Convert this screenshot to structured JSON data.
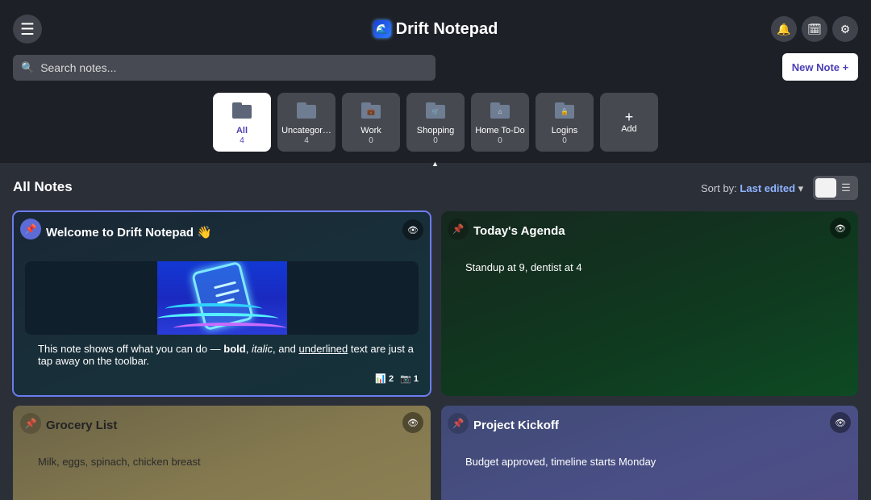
{
  "app": {
    "title": "Drift Notepad",
    "logo_glyph": "🌊",
    "menu_glyph": "☰",
    "bell_glyph": "🔔",
    "calendar_glyph": "🗓",
    "settings_glyph": "⚙"
  },
  "search": {
    "placeholder": "Search notes...",
    "icon_glyph": "🔍"
  },
  "new_note_label": "New Note +",
  "folders": [
    {
      "name": "All",
      "count": "4",
      "glyph": ""
    },
    {
      "name": "Uncategor…",
      "count": "4",
      "glyph": ""
    },
    {
      "name": "Work",
      "count": "0",
      "glyph": "💼"
    },
    {
      "name": "Shopping",
      "count": "0",
      "glyph": "🛒"
    },
    {
      "name": "Home To-Do",
      "count": "0",
      "glyph": "⌂"
    },
    {
      "name": "Logins",
      "count": "0",
      "glyph": "🔒"
    }
  ],
  "add_folder": {
    "glyph": "+",
    "label": "Add"
  },
  "caret_glyph": "▲",
  "section_title": "All Notes",
  "sort": {
    "label": "Sort by:",
    "value": "Last edited",
    "chevron": "▾"
  },
  "view_toggle": {
    "list_glyph": "☰"
  },
  "notes": {
    "welcome": {
      "title": "Welcome to Drift Notepad 👋",
      "pin_glyph": "📌",
      "eye_glyph": "👁",
      "body_parts": {
        "p1": "This note shows off what you can do — ",
        "bold": "bold",
        "p2": ", ",
        "italic": "italic",
        "p3": ", and ",
        "underlined": "underlined",
        "p4": " text are just a tap away on the toolbar."
      },
      "stats": {
        "charts_glyph": "📊",
        "charts": "2",
        "photos_glyph": "📷",
        "photos": "1"
      }
    },
    "agenda": {
      "title": "Today's Agenda",
      "body": "Standup at 9, dentist at 4",
      "pin_glyph": "📌",
      "eye_glyph": "👁"
    },
    "grocery": {
      "title": "Grocery List",
      "body": "Milk, eggs, spinach, chicken breast",
      "pin_glyph": "📌",
      "eye_glyph": "👁"
    },
    "project": {
      "title": "Project Kickoff",
      "body": "Budget approved, timeline starts Monday",
      "pin_glyph": "📌",
      "eye_glyph": "👁"
    }
  },
  "colors": {
    "accent": "#4c3fb5",
    "header_bg": "#1e2027",
    "page_bg": "#2b2f38",
    "selected_border": "#6b7cf0",
    "sort_value": "#8fb3ff"
  }
}
